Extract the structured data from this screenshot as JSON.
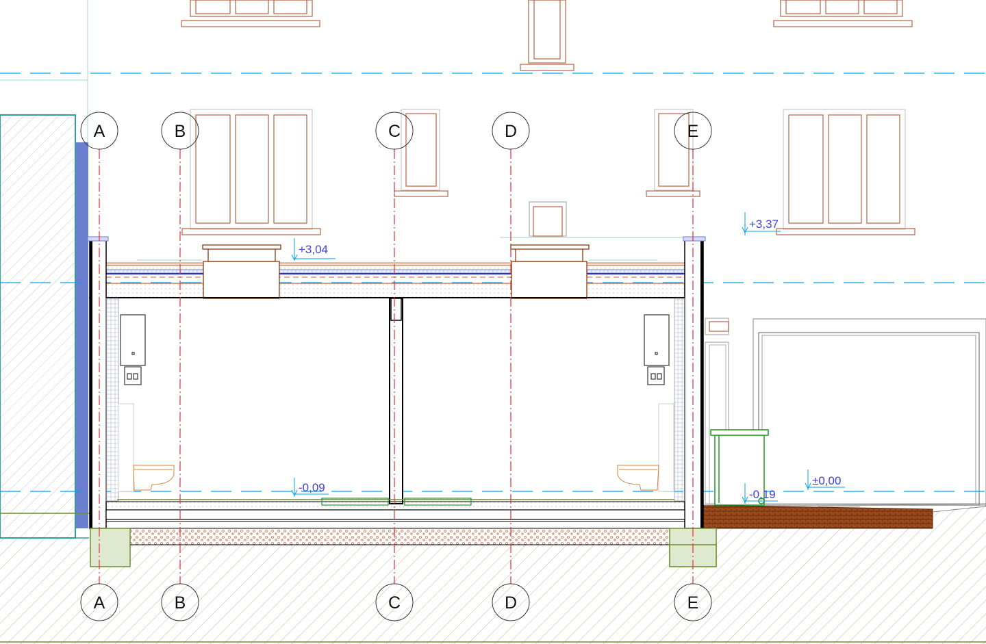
{
  "grid_axes": [
    {
      "label": "A"
    },
    {
      "label": "B"
    },
    {
      "label": "C"
    },
    {
      "label": "D"
    },
    {
      "label": "E"
    }
  ],
  "levels": {
    "roof_top": "+3,04",
    "adjacent_roof": "+3,37",
    "floor": "-0,09",
    "terrace": "-0,19",
    "street": "±0,00"
  },
  "colors": {
    "building_outline": "#b5623f",
    "datum_line": "#00a0e9",
    "grid_line": "#e0303a",
    "level_text": "#4040e0",
    "structure": "#000000",
    "neighbour_wall": "#2f9f9a",
    "membrane": "#6a7fd0",
    "earth_hatch": "#c9b29a",
    "brick": "#8a3a12",
    "bin": "#1a9a1a",
    "footing": "#6f8f2f"
  },
  "icons": [
    "wall-boiler-icon",
    "toilet-icon",
    "wheelie-bin-icon",
    "level-marker-icon"
  ]
}
